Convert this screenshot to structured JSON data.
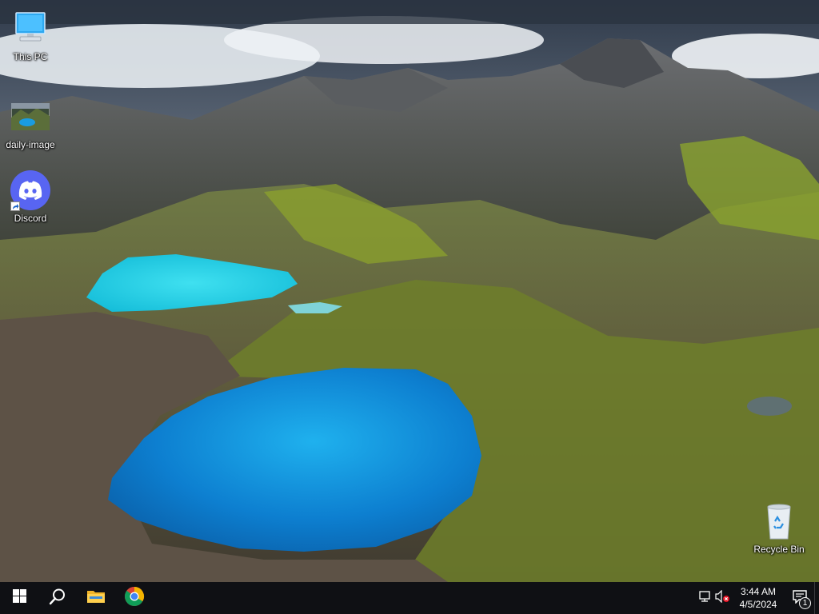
{
  "desktop": {
    "icons": [
      {
        "label": "This PC",
        "icon": "computer-icon"
      },
      {
        "label": "daily-image",
        "icon": "image-file-icon"
      },
      {
        "label": "Discord",
        "icon": "discord-icon"
      },
      {
        "label": "Recycle Bin",
        "icon": "recycle-bin-icon"
      }
    ]
  },
  "taskbar": {
    "start_icon": "windows-logo-icon",
    "search_icon": "search-icon",
    "pinned": [
      {
        "name": "File Explorer",
        "icon": "folder-icon"
      },
      {
        "name": "Google Chrome",
        "icon": "chrome-icon"
      }
    ],
    "tray": {
      "network_icon": "network-icon",
      "volume_icon": "volume-muted-icon",
      "time": "3:44 AM",
      "date": "4/5/2024",
      "notification_icon": "action-center-icon",
      "notification_count": "1"
    }
  },
  "colors": {
    "taskbar": "#0f1014",
    "discord": "#5865f2",
    "folder": "#f0b429",
    "accent": "#7db7ff"
  }
}
